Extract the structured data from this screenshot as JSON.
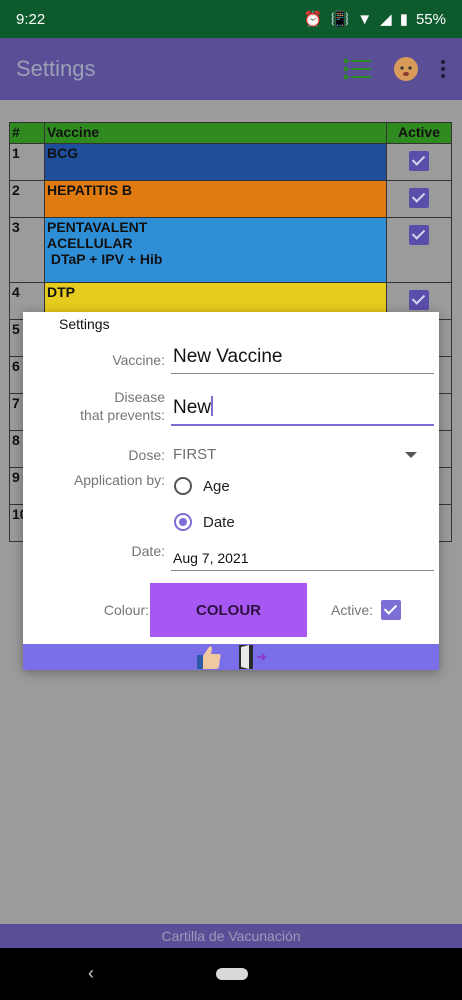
{
  "status": {
    "time": "9:22",
    "battery": "55%"
  },
  "appbar": {
    "title": "Settings"
  },
  "table": {
    "headers": [
      "#",
      "Vaccine",
      "Active"
    ],
    "rows": [
      {
        "num": "1",
        "lines": [
          "BCG"
        ],
        "color": "#1f4e9a"
      },
      {
        "num": "2",
        "lines": [
          "HEPATITIS B"
        ],
        "color": "#e07b12"
      },
      {
        "num": "3",
        "lines": [
          "PENTAVALENT",
          "ACELLULAR",
          " DTaP + IPV + Hib"
        ],
        "color": "#2f8fd6"
      },
      {
        "num": "4",
        "lines": [
          "DTP"
        ],
        "color": "#e6cc1e"
      },
      {
        "num": "5",
        "lines": [
          ""
        ],
        "color": "#9b9b9b"
      },
      {
        "num": "6",
        "lines": [
          ""
        ],
        "color": "#9b9b9b"
      },
      {
        "num": "7",
        "lines": [
          ""
        ],
        "color": "#9b9b9b"
      },
      {
        "num": "8",
        "lines": [
          ""
        ],
        "color": "#9b9b9b"
      },
      {
        "num": "9",
        "lines": [
          ""
        ],
        "color": "#9b9b9b"
      },
      {
        "num": "10",
        "lines": [
          ""
        ],
        "color": "#9b9b9b"
      }
    ]
  },
  "dialog": {
    "title": "Settings",
    "vaccine_label": "Vaccine:",
    "vaccine_value": "New Vaccine",
    "disease_label_1": "Disease",
    "disease_label_2": "that prevents:",
    "disease_value": "New",
    "dose_label": "Dose:",
    "dose_value": "FIRST",
    "application_label": "Application by:",
    "option_age": "Age",
    "option_date": "Date",
    "date_label": "Date:",
    "date_value": "Aug 7, 2021",
    "colour_label": "Colour:",
    "colour_button": "COLOUR",
    "active_label": "Active:"
  },
  "footer": {
    "text": "Cartilla de Vacunación"
  }
}
